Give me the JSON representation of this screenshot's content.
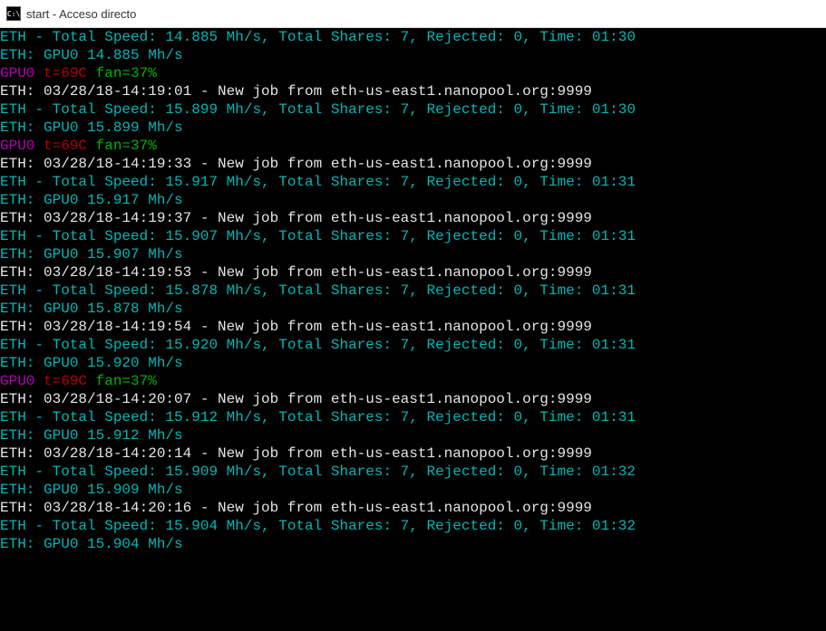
{
  "window": {
    "title": "start - Acceso directo",
    "icon_label": "C:\\"
  },
  "lines": [
    {
      "segments": [
        {
          "cls": "c-teal",
          "text": "ETH - Total Speed: 14.885 Mh/s, Total Shares: 7, Rejected: 0, Time: 01:30"
        }
      ]
    },
    {
      "segments": [
        {
          "cls": "c-teal",
          "text": "ETH: GPU0 14.885 Mh/s"
        }
      ]
    },
    {
      "segments": [
        {
          "cls": "c-magenta",
          "text": "GPU0"
        },
        {
          "cls": "c-red",
          "text": " t=69C"
        },
        {
          "cls": "c-green",
          "text": " fan=37%"
        }
      ]
    },
    {
      "segments": [
        {
          "cls": "c-white",
          "text": "ETH: 03/28/18-14:19:01 - New job from eth-us-east1.nanopool.org:9999"
        }
      ]
    },
    {
      "segments": [
        {
          "cls": "c-teal",
          "text": "ETH - Total Speed: 15.899 Mh/s, Total Shares: 7, Rejected: 0, Time: 01:30"
        }
      ]
    },
    {
      "segments": [
        {
          "cls": "c-teal",
          "text": "ETH: GPU0 15.899 Mh/s"
        }
      ]
    },
    {
      "segments": [
        {
          "cls": "c-magenta",
          "text": "GPU0"
        },
        {
          "cls": "c-red",
          "text": " t=69C"
        },
        {
          "cls": "c-green",
          "text": " fan=37%"
        }
      ]
    },
    {
      "segments": [
        {
          "cls": "c-white",
          "text": "ETH: 03/28/18-14:19:33 - New job from eth-us-east1.nanopool.org:9999"
        }
      ]
    },
    {
      "segments": [
        {
          "cls": "c-teal",
          "text": "ETH - Total Speed: 15.917 Mh/s, Total Shares: 7, Rejected: 0, Time: 01:31"
        }
      ]
    },
    {
      "segments": [
        {
          "cls": "c-teal",
          "text": "ETH: GPU0 15.917 Mh/s"
        }
      ]
    },
    {
      "segments": [
        {
          "cls": "c-white",
          "text": "ETH: 03/28/18-14:19:37 - New job from eth-us-east1.nanopool.org:9999"
        }
      ]
    },
    {
      "segments": [
        {
          "cls": "c-teal",
          "text": "ETH - Total Speed: 15.907 Mh/s, Total Shares: 7, Rejected: 0, Time: 01:31"
        }
      ]
    },
    {
      "segments": [
        {
          "cls": "c-teal",
          "text": "ETH: GPU0 15.907 Mh/s"
        }
      ]
    },
    {
      "segments": [
        {
          "cls": "c-white",
          "text": "ETH: 03/28/18-14:19:53 - New job from eth-us-east1.nanopool.org:9999"
        }
      ]
    },
    {
      "segments": [
        {
          "cls": "c-teal",
          "text": "ETH - Total Speed: 15.878 Mh/s, Total Shares: 7, Rejected: 0, Time: 01:31"
        }
      ]
    },
    {
      "segments": [
        {
          "cls": "c-teal",
          "text": "ETH: GPU0 15.878 Mh/s"
        }
      ]
    },
    {
      "segments": [
        {
          "cls": "c-white",
          "text": "ETH: 03/28/18-14:19:54 - New job from eth-us-east1.nanopool.org:9999"
        }
      ]
    },
    {
      "segments": [
        {
          "cls": "c-teal",
          "text": "ETH - Total Speed: 15.920 Mh/s, Total Shares: 7, Rejected: 0, Time: 01:31"
        }
      ]
    },
    {
      "segments": [
        {
          "cls": "c-teal",
          "text": "ETH: GPU0 15.920 Mh/s"
        }
      ]
    },
    {
      "segments": [
        {
          "cls": "c-magenta",
          "text": "GPU0"
        },
        {
          "cls": "c-red",
          "text": " t=69C"
        },
        {
          "cls": "c-green",
          "text": " fan=37%"
        }
      ]
    },
    {
      "segments": [
        {
          "cls": "c-white",
          "text": "ETH: 03/28/18-14:20:07 - New job from eth-us-east1.nanopool.org:9999"
        }
      ]
    },
    {
      "segments": [
        {
          "cls": "c-teal",
          "text": "ETH - Total Speed: 15.912 Mh/s, Total Shares: 7, Rejected: 0, Time: 01:31"
        }
      ]
    },
    {
      "segments": [
        {
          "cls": "c-teal",
          "text": "ETH: GPU0 15.912 Mh/s"
        }
      ]
    },
    {
      "segments": [
        {
          "cls": "c-white",
          "text": "ETH: 03/28/18-14:20:14 - New job from eth-us-east1.nanopool.org:9999"
        }
      ]
    },
    {
      "segments": [
        {
          "cls": "c-teal",
          "text": "ETH - Total Speed: 15.909 Mh/s, Total Shares: 7, Rejected: 0, Time: 01:32"
        }
      ]
    },
    {
      "segments": [
        {
          "cls": "c-teal",
          "text": "ETH: GPU0 15.909 Mh/s"
        }
      ]
    },
    {
      "segments": [
        {
          "cls": "c-white",
          "text": "ETH: 03/28/18-14:20:16 - New job from eth-us-east1.nanopool.org:9999"
        }
      ]
    },
    {
      "segments": [
        {
          "cls": "c-teal",
          "text": "ETH - Total Speed: 15.904 Mh/s, Total Shares: 7, Rejected: 0, Time: 01:32"
        }
      ]
    },
    {
      "segments": [
        {
          "cls": "c-teal",
          "text": "ETH: GPU0 15.904 Mh/s"
        }
      ]
    }
  ]
}
